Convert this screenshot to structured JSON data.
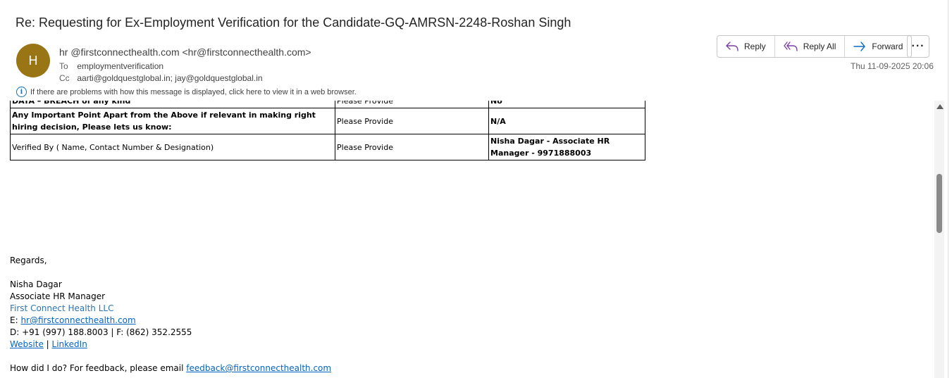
{
  "email": {
    "subject": "Re: Requesting for Ex-Employment Verification for the Candidate-GQ-AMRSN-2248-Roshan Singh",
    "avatar_initial": "H",
    "avatar_color": "#9a7516",
    "from": "hr @firstconnecthealth.com <hr@firstconnecthealth.com>",
    "to_label": "To",
    "to": "employmentverification",
    "cc_label": "Cc",
    "cc": "aarti@goldquestglobal.in; jay@goldquestglobal.in",
    "info_message": "If there are problems with how this message is displayed, click here to view it in a web browser.",
    "date": "Thu 11-09-2025 20:06"
  },
  "actions": {
    "reply": "Reply",
    "reply_all": "Reply All",
    "forward": "Forward",
    "more": "···"
  },
  "table": {
    "rows": [
      {
        "c1": "DATA – BREACH of any kind",
        "c2": "Please Provide",
        "c3": "No"
      },
      {
        "c1": "Any Important Point Apart from the Above if relevant in making right hiring decision, Please lets us know:",
        "c2": "Please Provide",
        "c3": "N/A"
      },
      {
        "c1": "Verified By ( Name, Contact Number & Designation)",
        "c2": "Please Provide",
        "c3": "Nisha Dagar - Associate HR Manager - 9971888003"
      }
    ]
  },
  "signature": {
    "regards": "Regards,",
    "name": "Nisha Dagar",
    "title": "Associate HR Manager",
    "company": "First Connect Health LLC",
    "email_prefix": "E: ",
    "email": "hr@firstconnecthealth.com",
    "phone": "D: +91 (997) 188.8003 | F: (862) 352.2555",
    "website": "Website",
    "separator": " | ",
    "linkedin": "LinkedIn",
    "feedback_prefix": "How did I do? For feedback, please email ",
    "feedback_email": "feedback@firstconnecthealth.com"
  },
  "colors": {
    "accent": "#0f6cbd",
    "link": "#0563c1",
    "company": "#2e74b5"
  }
}
